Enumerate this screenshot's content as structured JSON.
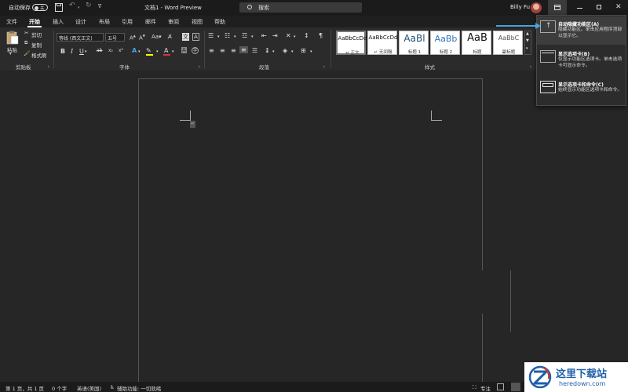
{
  "titlebar": {
    "autosave_label": "自动保存",
    "autosave_state": "关",
    "doc_title": "文档1 - Word Preview",
    "search_placeholder": "搜索",
    "user_name": "Billy Fu"
  },
  "tabs": [
    "文件",
    "开始",
    "插入",
    "设计",
    "布局",
    "引用",
    "邮件",
    "审阅",
    "视图",
    "帮助"
  ],
  "ribbon": {
    "clipboard": {
      "paste": "粘贴",
      "cut": "剪切",
      "copy": "复制",
      "format_painter": "格式刷",
      "label": "剪贴板"
    },
    "font": {
      "name": "等线 (西文正文)",
      "size": "五号",
      "label": "字体"
    },
    "paragraph": {
      "label": "段落"
    },
    "styles": {
      "label": "样式",
      "items": [
        {
          "sample": "AaBbCcDd",
          "name": "↵ 正文"
        },
        {
          "sample": "AaBbCcDd",
          "name": "↵ 无间隔"
        },
        {
          "sample": "AaBl",
          "name": "标题 1"
        },
        {
          "sample": "AaBb",
          "name": "标题 2"
        },
        {
          "sample": "AaB",
          "name": "标题"
        },
        {
          "sample": "AaBbC",
          "name": "副标题"
        }
      ]
    }
  },
  "dropdown": {
    "items": [
      {
        "title": "自动隐藏功能区(A)",
        "desc": "隐藏功能区。单击应用程序顶部以显示它。"
      },
      {
        "title": "显示选项卡(B)",
        "desc": "仅显示功能区选项卡。单击选项卡可显示命令。"
      },
      {
        "title": "显示选项卡和命令(C)",
        "desc": "始终显示功能区选项卡和命令。"
      }
    ]
  },
  "statusbar": {
    "page": "第 1 页，共 1 页",
    "words": "0 个字",
    "language": "英语(美国)",
    "accessibility": "辅助功能: 一切就绪",
    "focus": "专注"
  },
  "watermark": {
    "brand": "这里下载站",
    "url": "heredown.com"
  },
  "colors": {
    "accent_arrow": "#4aa3df",
    "dark_bg": "#262626"
  }
}
